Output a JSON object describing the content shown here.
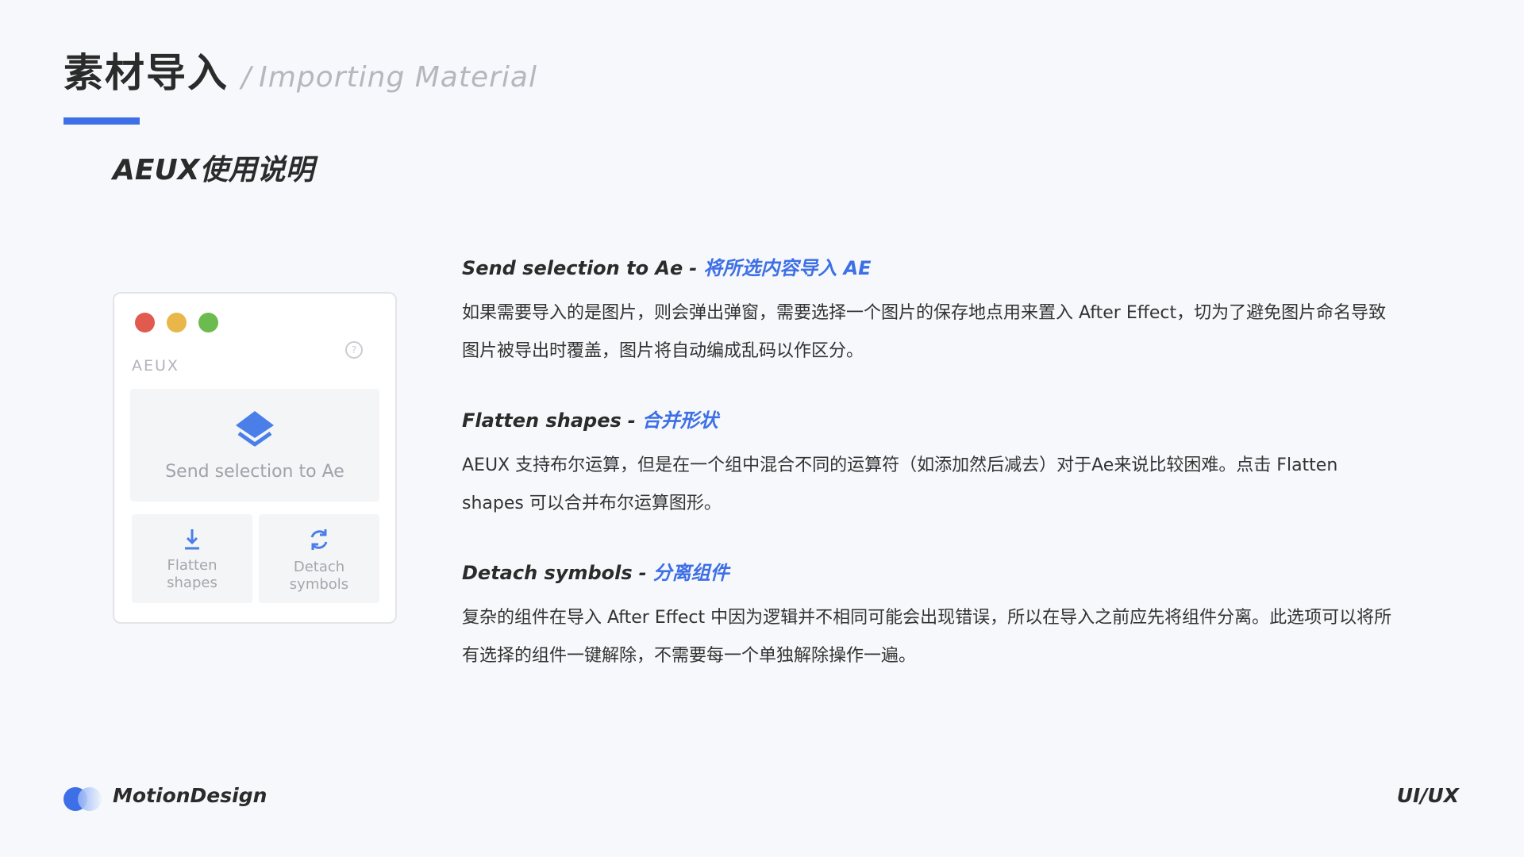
{
  "header": {
    "title_zh": "素材导入",
    "slash": "/",
    "title_en": "Importing Material",
    "subtitle": "AEUX使用说明"
  },
  "panel": {
    "label": "AEUX",
    "send_button": "Send selection to Ae",
    "flatten_button": "Flatten shapes",
    "detach_button": "Detach symbols",
    "icons": [
      "layers-icon",
      "download-icon",
      "refresh-icon",
      "help-icon"
    ]
  },
  "sections": [
    {
      "head_en": "Send selection to Ae",
      "dash": "-",
      "head_zh": "将所选内容导入 AE",
      "body": "如果需要导入的是图片，则会弹出弹窗，需要选择一个图片的保存地点用来置入 After Effect，切为了避免图片命名导致图片被导出时覆盖，图片将自动编成乱码以作区分。"
    },
    {
      "head_en": "Flatten shapes",
      "dash": "-",
      "head_zh": "合并形状",
      "body": "AEUX 支持布尔运算，但是在一个组中混合不同的运算符（如添加然后减去）对于Ae来说比较困难。点击 Flatten shapes 可以合并布尔运算图形。"
    },
    {
      "head_en": "Detach symbols",
      "dash": "-",
      "head_zh": "分离组件",
      "body": "复杂的组件在导入 After Effect 中因为逻辑并不相同可能会出现错误，所以在导入之前应先将组件分离。此选项可以将所有选择的组件一键解除，不需要每一个单独解除操作一遍。"
    }
  ],
  "footer": {
    "brand": "MotionDesign",
    "tag": "UI/UX"
  },
  "colors": {
    "accent": "#3d6fe6",
    "background": "#f7f8fb",
    "traffic_red": "#e05a4f",
    "traffic_yellow": "#e9b64a",
    "traffic_green": "#6cbb4f"
  }
}
